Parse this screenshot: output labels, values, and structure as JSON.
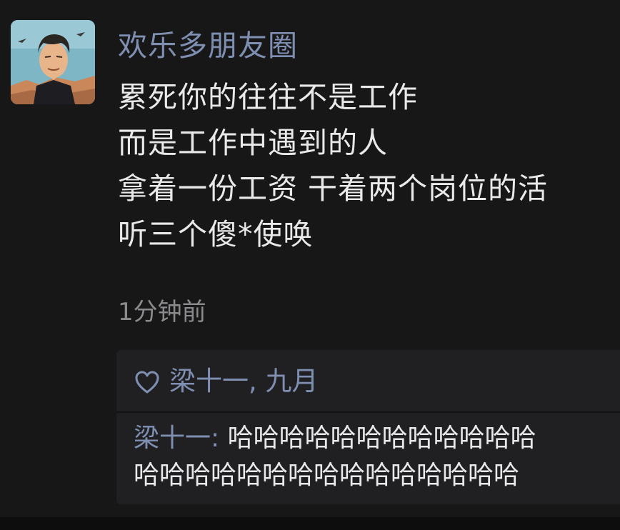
{
  "post": {
    "author": "欢乐多朋友圈",
    "lines": [
      "累死你的往往不是工作",
      "而是工作中遇到的人",
      "拿着一份工资 干着两个岗位的活",
      "听三个傻*使唤"
    ],
    "time": "1分钟前"
  },
  "likes": {
    "icon": "heart-outline-icon",
    "names": "梁十一, 九月"
  },
  "comment": {
    "author": "梁十一",
    "separator": ": ",
    "line1": "哈哈哈哈哈哈哈哈哈哈哈哈",
    "line2": "哈哈哈哈哈哈哈哈哈哈哈哈哈哈哈"
  },
  "colors": {
    "background": "#171718",
    "name_link": "#7f8fb2",
    "text": "#e9e9ea",
    "timestamp": "#8b8b8e",
    "comment_box": "#202022"
  }
}
